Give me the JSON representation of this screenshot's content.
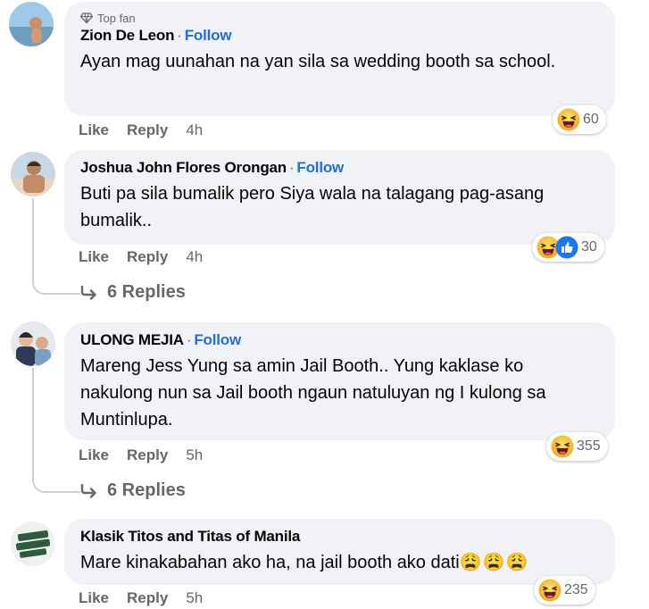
{
  "comments": [
    {
      "badge": "Top fan",
      "name": "Zion De Leon",
      "follow": "Follow",
      "text": "Ayan mag uunahan na yan sila sa wedding booth sa school.",
      "like": "Like",
      "reply": "Reply",
      "time": "4h",
      "reaction_count": "60"
    },
    {
      "name": "Joshua John Flores Orongan",
      "follow": "Follow",
      "text": "Buti pa sila bumalik pero Siya wala na talagang pag-asang bumalik..",
      "like": "Like",
      "reply": "Reply",
      "time": "4h",
      "reaction_count": "30",
      "replies": "6 Replies"
    },
    {
      "name": "ULONG MEJIA",
      "follow": "Follow",
      "text": "Mareng Jess Yung sa amin Jail Booth.. Yung kaklase ko nakulong nun sa Jail booth ngaun natuluyan ng I kulong sa Muntinlupa.",
      "like": "Like",
      "reply": "Reply",
      "time": "5h",
      "reaction_count": "355",
      "replies": "6 Replies"
    },
    {
      "name": "Klasik Titos and Titas of Manila",
      "text": "Mare kinakabahan ako ha, na jail booth ako dati",
      "emoji": "😩😩😩",
      "like": "Like",
      "reply": "Reply",
      "time": "5h",
      "reaction_count": "235"
    }
  ],
  "separator": "·",
  "colors": {
    "follow": "#216fdb",
    "bubble": "#f0f2f5",
    "meta": "#65676b",
    "like_blue": "#1877f2",
    "haha_yellow": "#f7c544"
  },
  "icons": {
    "badge": "diamond-icon",
    "reaction_haha": "haha-icon",
    "reaction_like": "like-icon",
    "replies": "reply-arrow-icon"
  }
}
